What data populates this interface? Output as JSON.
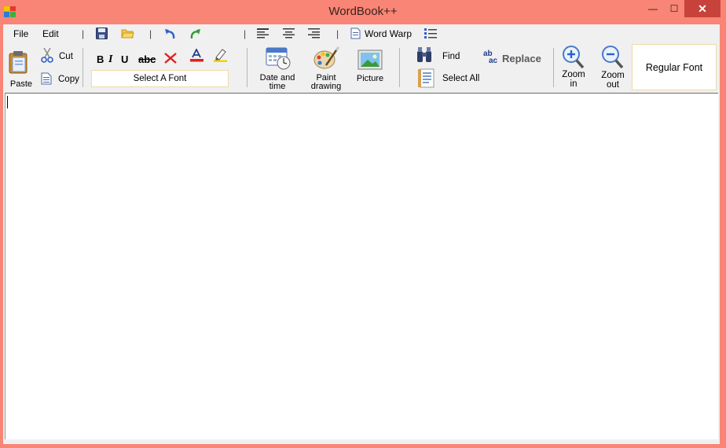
{
  "window": {
    "title": "WordBook++",
    "minimize_glyph": "—",
    "maximize_glyph": "☐",
    "close_glyph": "✕"
  },
  "menu": {
    "file": "File",
    "edit": "Edit",
    "pipe1": "|",
    "pipe2": "|",
    "pipe3": "|",
    "pipe4": "|",
    "word_wrap": "Word Warp"
  },
  "toolbar": {
    "paste": "Paste",
    "cut": "Cut",
    "copy": "Copy",
    "bold": "B",
    "italic": "I",
    "underline": "U",
    "strike": "abc",
    "font_selector": "Select A Font",
    "date_time": "Date and time",
    "date_time_l1": "Date and",
    "date_time_l2": "time",
    "paint_l1": "Paint",
    "paint_l2": "drawing",
    "picture": "Picture",
    "find": "Find",
    "select_all": "Select All",
    "replace": "Replace",
    "replace_icon_top": "ab",
    "replace_icon_bottom": "ac",
    "zoom_in_l1": "Zoom",
    "zoom_in_l2": "in",
    "zoom_out_l1": "Zoom",
    "zoom_out_l2": "out",
    "font_preview": "Regular Font"
  },
  "icons": {
    "app": "app-icon",
    "save": "save-icon",
    "open": "folder-icon",
    "undo": "undo-icon",
    "redo": "redo-icon",
    "align_left": "align-left-icon",
    "align_center": "align-center-icon",
    "align_right": "align-right-icon",
    "list": "list-icon"
  },
  "colors": {
    "frame": "#f88575",
    "close_button": "#c7423a",
    "client": "#f0f0f0",
    "font_box_border": "#f2d8a8"
  },
  "editor": {
    "content": ""
  }
}
